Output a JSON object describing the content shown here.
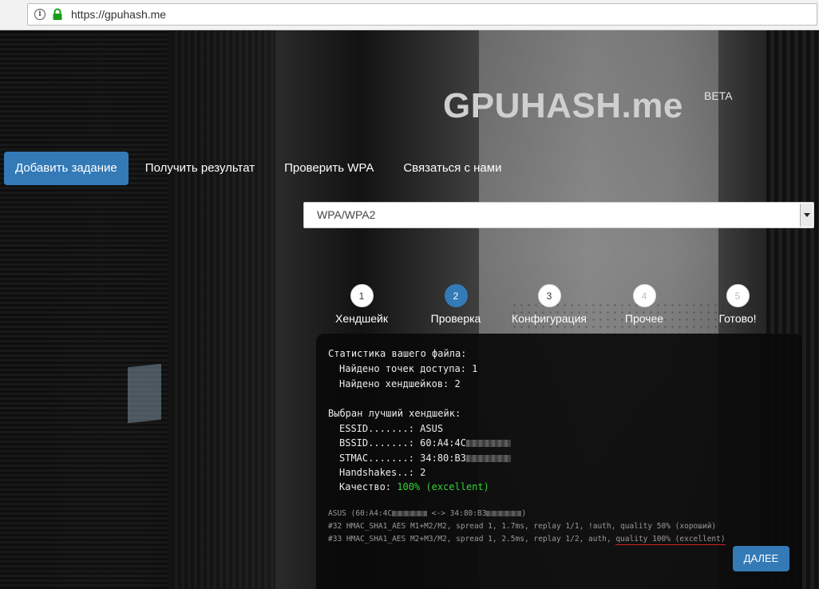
{
  "browser": {
    "url": "https://gpuhash.me"
  },
  "logo": {
    "title": "GPUHASH.me",
    "badge": "BETA"
  },
  "nav": {
    "items": [
      {
        "label": "Добавить задание",
        "active": true
      },
      {
        "label": "Получить результат",
        "active": false
      },
      {
        "label": "Проверить WPA",
        "active": false
      },
      {
        "label": "Связаться с нами",
        "active": false
      }
    ]
  },
  "select": {
    "value": "WPA/WPA2"
  },
  "steps": [
    {
      "number": "1",
      "label": "Хендшейк"
    },
    {
      "number": "2",
      "label": "Проверка"
    },
    {
      "number": "3",
      "label": "Конфигурация"
    },
    {
      "number": "4",
      "label": "Прочее"
    },
    {
      "number": "5",
      "label": "Готово!"
    }
  ],
  "stats": {
    "heading": "Статистика вашего файла:",
    "ap_found": "Найдено точек доступа: 1",
    "hs_found": "Найдено хендшейков: 2",
    "best_heading": "Выбран лучший хендшейк:",
    "essid": "ESSID.......: ASUS",
    "bssid": "BSSID.......: 60:A4:4C",
    "stmac": "STMAC.......: 34:80:B3",
    "handshakes": "Handshakes..: 2",
    "quality_label": "Качество: ",
    "quality_value": "100% (excellent)"
  },
  "log": {
    "pair_prefix": "ASUS (60:A4:4C",
    "pair_mid": " <-> 34:80:B3",
    "pair_suffix": ")",
    "line32": "#32 HMAC_SHA1_AES M1+M2/M2, spread 1, 1.7ms, replay 1/1, !auth, quality 50% (хороший)",
    "line33_prefix": "#33 HMAC_SHA1_AES M2+M3/M2, spread 1, 2.5ms, replay 1/2, auth, ",
    "line33_highlight": "quality 100% (excellent)"
  },
  "next_button": "ДАЛЕЕ"
}
